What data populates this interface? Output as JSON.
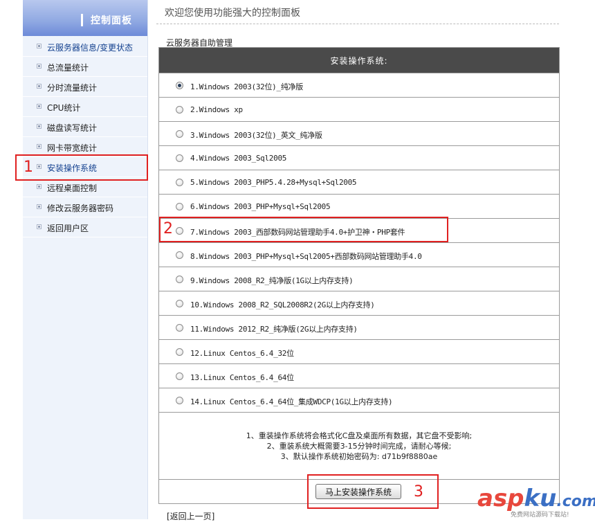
{
  "sidebar": {
    "title": "控制面板",
    "items": [
      {
        "label": "云服务器信息/变更状态"
      },
      {
        "label": "总流量统计"
      },
      {
        "label": "分时流量统计"
      },
      {
        "label": "CPU统计"
      },
      {
        "label": "磁盘读写统计"
      },
      {
        "label": "网卡带宽统计"
      },
      {
        "label": "安装操作系统"
      },
      {
        "label": "远程桌面控制"
      },
      {
        "label": "修改云服务器密码"
      },
      {
        "label": "返回用户区"
      }
    ]
  },
  "header": {
    "title": "欢迎您使用功能强大的控制面板"
  },
  "section": {
    "label": "云服务器自助管理"
  },
  "os_table": {
    "heading": "安装操作系统:",
    "selected_index": 0,
    "options": [
      {
        "label": "1.Windows 2003(32位)_纯净版"
      },
      {
        "label": "2.Windows xp"
      },
      {
        "label": "3.Windows 2003(32位)_英文_纯净版"
      },
      {
        "label": "4.Windows 2003_Sql2005"
      },
      {
        "label": "5.Windows 2003_PHP5.4.28+Mysql+Sql2005"
      },
      {
        "label": "6.Windows 2003_PHP+Mysql+Sql2005"
      },
      {
        "label": "7.Windows 2003_西部数码网站管理助手4.0+护卫神・PHP套件"
      },
      {
        "label": "8.Windows 2003_PHP+Mysql+Sql2005+西部数码网站管理助手4.0"
      },
      {
        "label": "9.Windows 2008_R2_纯净版(1G以上内存支持)"
      },
      {
        "label": "10.Windows 2008_R2_SQL2008R2(2G以上内存支持)"
      },
      {
        "label": "11.Windows 2012_R2_纯净版(2G以上内存支持)"
      },
      {
        "label": "12.Linux Centos_6.4_32位"
      },
      {
        "label": "13.Linux Centos_6.4_64位"
      },
      {
        "label": "14.Linux Centos_6.4_64位_集成WDCP(1G以上内存支持)"
      }
    ],
    "notes": [
      "1、重装操作系统将会格式化C盘及桌面所有数据，其它盘不受影响;",
      "2、重装系统大概需要3-15分钟时间完成，请耐心等候;",
      "3、默认操作系统初始密码为: d71b9f8880ae"
    ],
    "submit_label": "马上安装操作系统"
  },
  "back_link": "[返回上一页]",
  "annotations": {
    "n1": "1",
    "n2": "2",
    "n3": "3",
    "color": "#e02020"
  },
  "watermark": {
    "logo_a": "asp",
    "logo_b": "ku",
    "logo_c": ".com",
    "sub": "免费网站源码下载站!"
  }
}
